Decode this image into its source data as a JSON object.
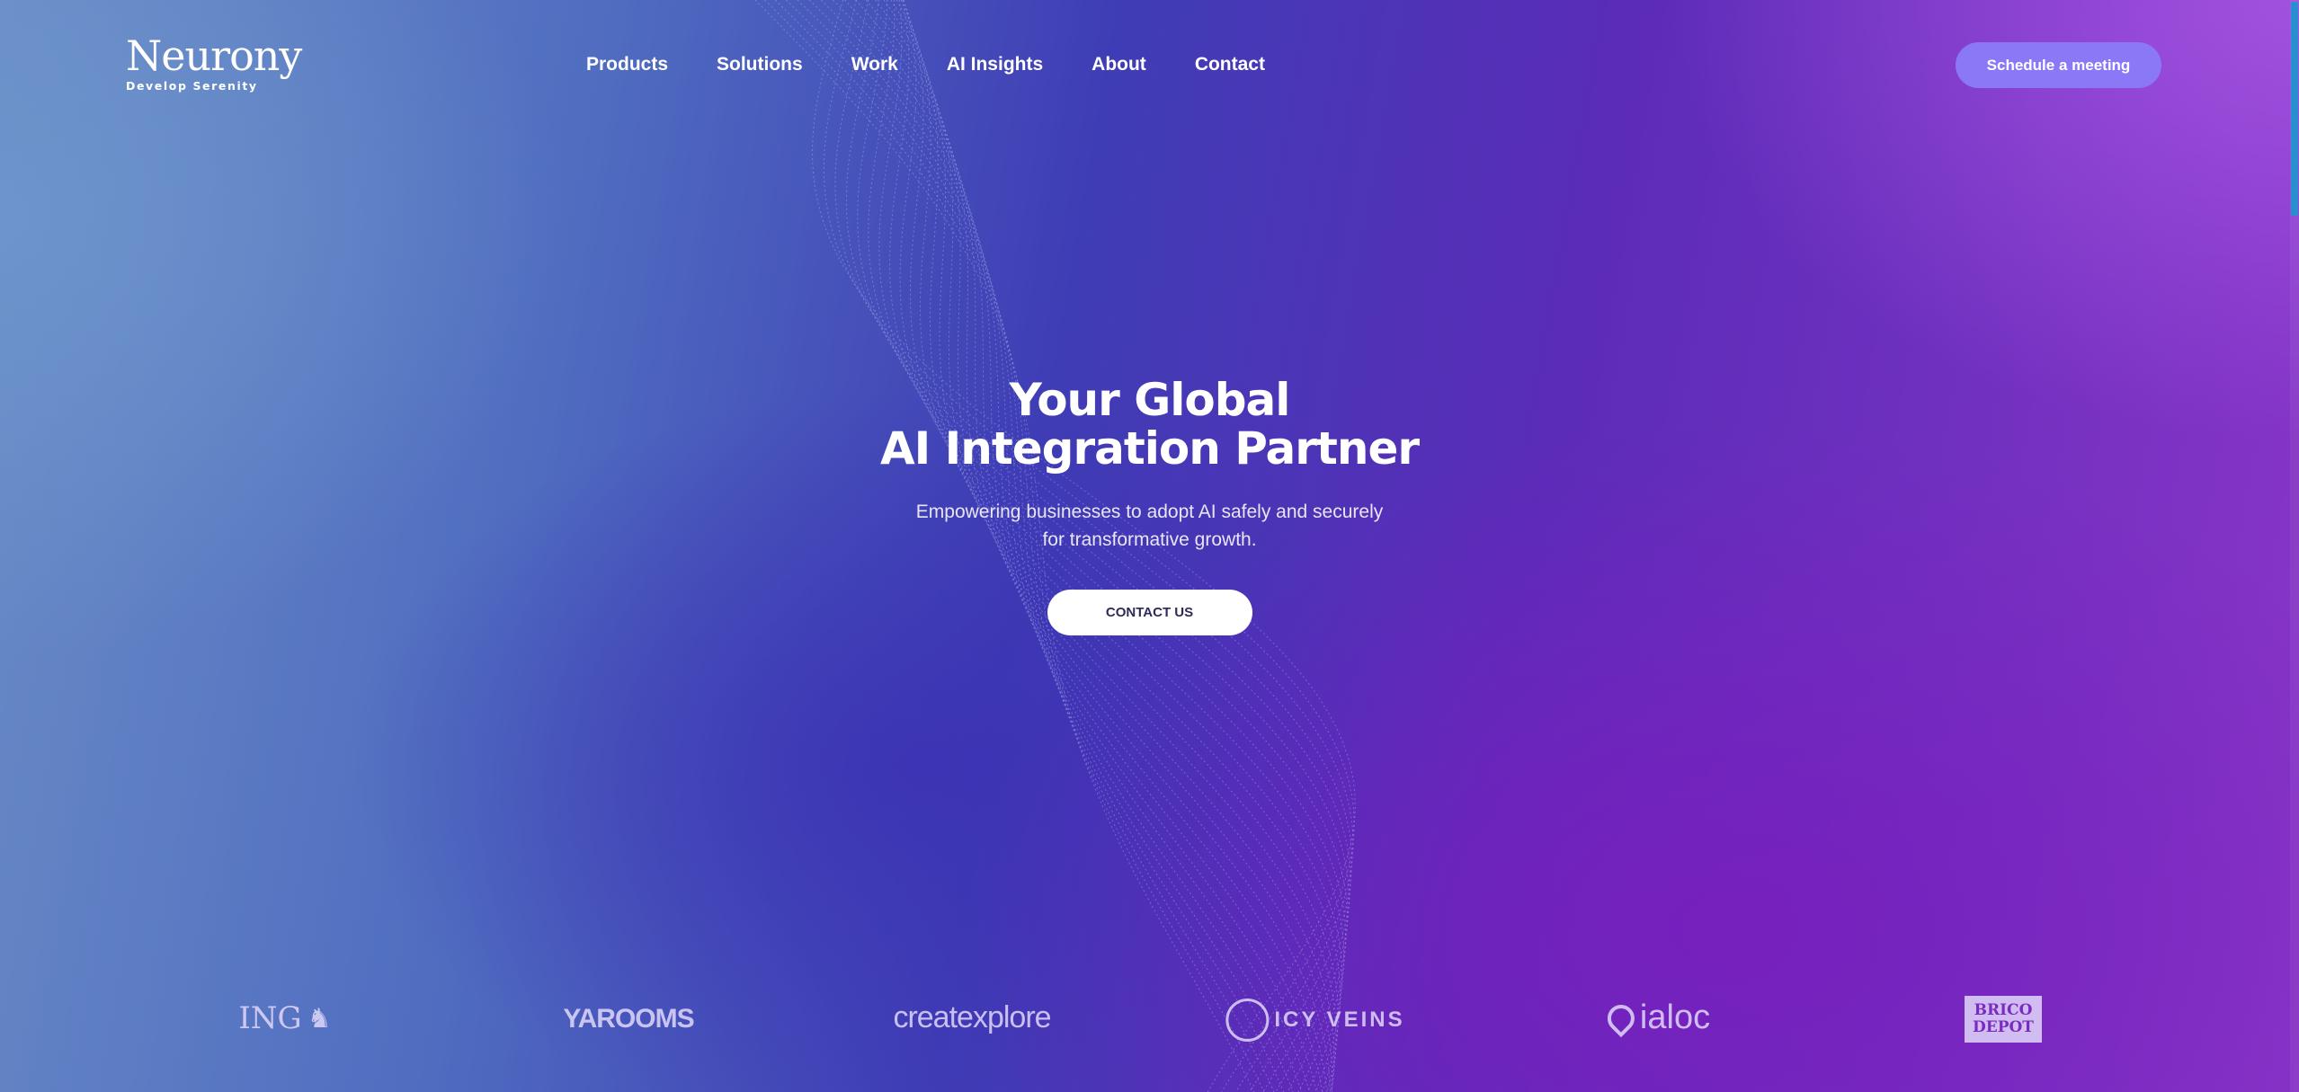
{
  "header": {
    "logo_name": "Neurony",
    "logo_tagline": "Develop Serenity",
    "nav": [
      "Products",
      "Solutions",
      "Work",
      "AI Insights",
      "About",
      "Contact"
    ],
    "cta_label": "Schedule a meeting"
  },
  "hero": {
    "title_line1": "Your Global",
    "title_line2": "AI Integration Partner",
    "subtitle_line1": "Empowering businesses to adopt AI safely and securely",
    "subtitle_line2": "for transformative growth.",
    "cta_label": "CONTACT US"
  },
  "clients": [
    "ING",
    "YAROOMS",
    "createxplore",
    "ICY VEINS",
    "ialoc",
    "BRICO DEPOT"
  ],
  "colors": {
    "schedule_button": "#8a78f6",
    "scrollbar_thumb": "#2a8fd0",
    "cta_text": "#2e2a5a"
  }
}
